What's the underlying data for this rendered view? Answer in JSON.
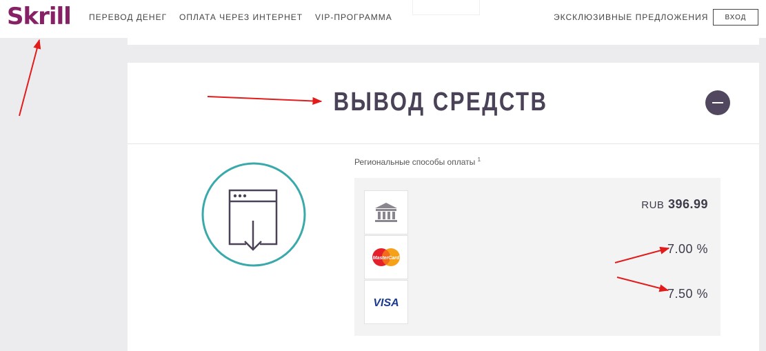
{
  "header": {
    "logo_text": "Skrill",
    "nav": [
      "ПЕРЕВОД ДЕНЕГ",
      "ОПЛАТА ЧЕРЕЗ ИНТЕРНЕТ",
      "VIP-ПРОГРАММА"
    ],
    "exclusive": "ЭКСКЛЮЗИВНЫЕ ПРЕДЛОЖЕНИЯ",
    "login": "ВХОД"
  },
  "section": {
    "title": "ВЫВОД СРЕДСТВ",
    "region_label": "Региональные способы оплаты",
    "region_sup": "1"
  },
  "methods": [
    {
      "icon": "bank-icon",
      "currency": "RUB",
      "value": "396.99"
    },
    {
      "icon": "mastercard-icon",
      "logo_text": "MasterCard",
      "value": "7.00 %"
    },
    {
      "icon": "visa-icon",
      "logo_text": "VISA",
      "value": "7.50 %"
    }
  ],
  "colors": {
    "brand": "#862165",
    "title": "#4a4357",
    "teal": "#3aa9a9",
    "annotation": "#e21b1b"
  }
}
